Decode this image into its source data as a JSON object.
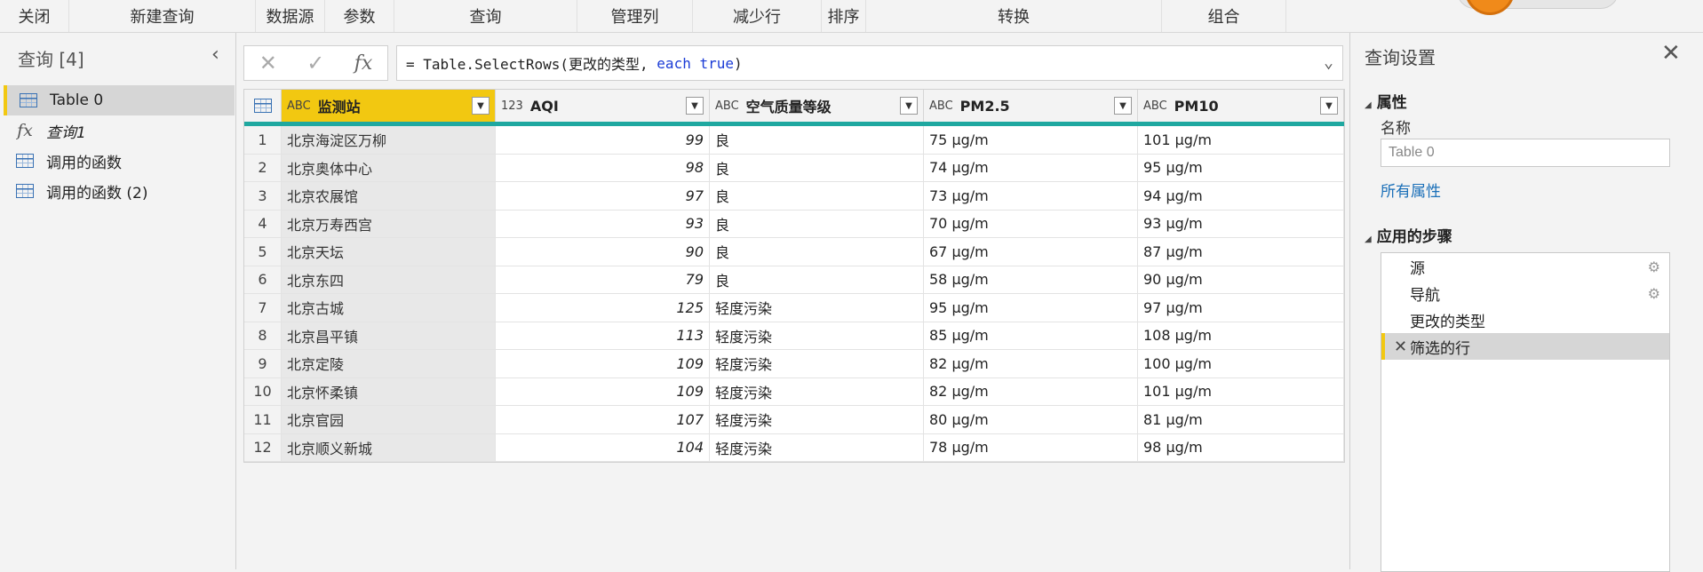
{
  "ribbon": {
    "groups": [
      "关闭",
      "新建查询",
      "数据源",
      "参数",
      "查询",
      "管理列",
      "减少行",
      "排序",
      "转换",
      "组合"
    ]
  },
  "queries_panel": {
    "title": "查询 [4]",
    "items": [
      {
        "label": "Table 0",
        "icon": "table-icon",
        "selected": true
      },
      {
        "label": "查询1",
        "icon": "fx-icon",
        "selected": false
      },
      {
        "label": "调用的函数",
        "icon": "table-icon",
        "selected": false
      },
      {
        "label": "调用的函数 (2)",
        "icon": "table-icon",
        "selected": false
      }
    ]
  },
  "formula_bar": {
    "cancel": "✕",
    "confirm": "✓",
    "fx": "fx",
    "prefix": "= Table.SelectRows(更改的类型, ",
    "kw1": "each",
    "space": " ",
    "kw2": "true",
    "suffix": ")"
  },
  "grid": {
    "columns": [
      {
        "type": "ABC",
        "name": "监测站"
      },
      {
        "type": "123",
        "name": "AQI"
      },
      {
        "type": "ABC",
        "name": "空气质量等级"
      },
      {
        "type": "ABC",
        "name": "PM2.5"
      },
      {
        "type": "ABC",
        "name": "PM10"
      }
    ],
    "rows": [
      [
        "1",
        "北京海淀区万柳",
        "99",
        "良",
        "75 µg/m",
        "101 µg/m"
      ],
      [
        "2",
        "北京奥体中心",
        "98",
        "良",
        "74 µg/m",
        "95 µg/m"
      ],
      [
        "3",
        "北京农展馆",
        "97",
        "良",
        "73 µg/m",
        "94 µg/m"
      ],
      [
        "4",
        "北京万寿西宫",
        "93",
        "良",
        "70 µg/m",
        "93 µg/m"
      ],
      [
        "5",
        "北京天坛",
        "90",
        "良",
        "67 µg/m",
        "87 µg/m"
      ],
      [
        "6",
        "北京东四",
        "79",
        "良",
        "58 µg/m",
        "90 µg/m"
      ],
      [
        "7",
        "北京古城",
        "125",
        "轻度污染",
        "95 µg/m",
        "97 µg/m"
      ],
      [
        "8",
        "北京昌平镇",
        "113",
        "轻度污染",
        "85 µg/m",
        "108 µg/m"
      ],
      [
        "9",
        "北京定陵",
        "109",
        "轻度污染",
        "82 µg/m",
        "100 µg/m"
      ],
      [
        "10",
        "北京怀柔镇",
        "109",
        "轻度污染",
        "82 µg/m",
        "101 µg/m"
      ],
      [
        "11",
        "北京官园",
        "107",
        "轻度污染",
        "80 µg/m",
        "81 µg/m"
      ],
      [
        "12",
        "北京顺义新城",
        "104",
        "轻度污染",
        "78 µg/m",
        "98 µg/m"
      ]
    ]
  },
  "settings_panel": {
    "title": "查询设置",
    "properties_header": "属性",
    "name_label": "名称",
    "name_value": "Table 0",
    "all_properties": "所有属性",
    "steps_header": "应用的步骤",
    "steps": [
      {
        "label": "源",
        "gear": true
      },
      {
        "label": "导航",
        "gear": true
      },
      {
        "label": "更改的类型",
        "gear": false
      },
      {
        "label": "筛选的行",
        "gear": false,
        "selected": true
      }
    ]
  },
  "colors": {
    "accent": "#f2c811",
    "teal": "#1fa8a0",
    "link": "#1a6fb8",
    "keyword": "#1a3bd6"
  }
}
